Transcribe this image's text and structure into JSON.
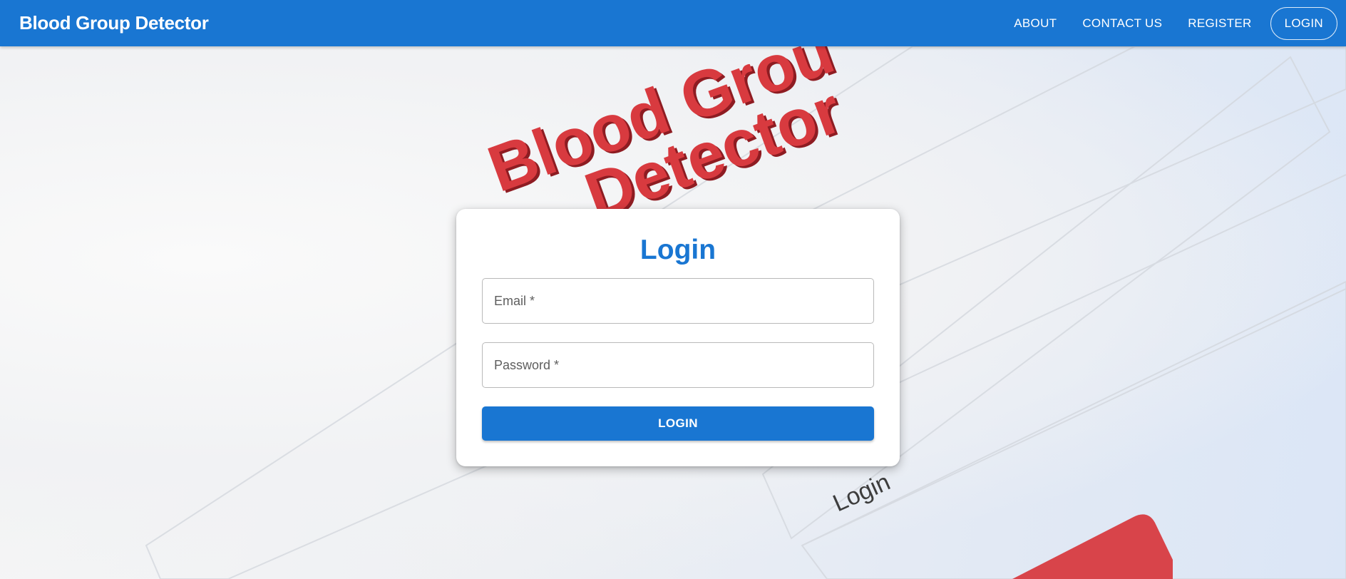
{
  "appbar": {
    "brand": "Blood Group Detector",
    "nav": {
      "about": "ABOUT",
      "contact": "CONTACT US",
      "register": "REGISTER",
      "login": "LOGIN"
    }
  },
  "background": {
    "logo_line1": "Blood Grou",
    "logo_line2": "Detector",
    "form_caption": "Login"
  },
  "login_card": {
    "title": "Login",
    "email_placeholder": "Email *",
    "password_placeholder": "Password *",
    "submit_label": "LOGIN"
  },
  "colors": {
    "primary": "#1976d2",
    "logo_red": "#d83a3f"
  }
}
